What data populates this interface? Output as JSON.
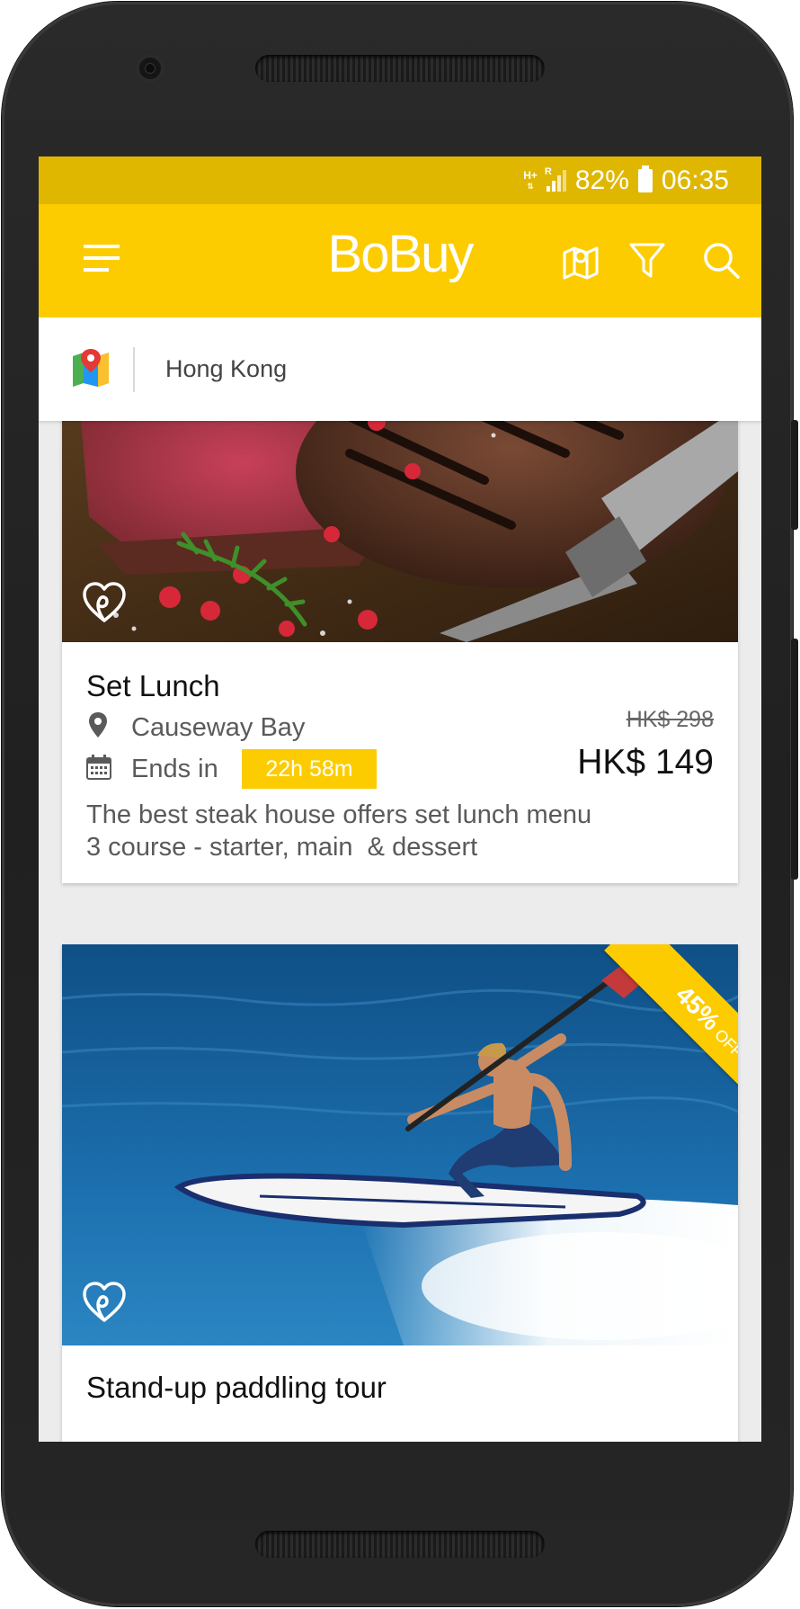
{
  "status_bar": {
    "network_top": "H+",
    "network_bottom": "R",
    "battery": "82%",
    "time": "06:35"
  },
  "app_bar": {
    "title": "BoBuy",
    "menu_icon": "hamburger-menu-icon",
    "map_icon": "map-icon",
    "filter_icon": "filter-icon",
    "search_icon": "search-icon"
  },
  "location": {
    "icon": "map-pin-icon",
    "city": "Hong Kong"
  },
  "deals": [
    {
      "title": "Set Lunch",
      "place": "Causeway Bay",
      "ends_label": "Ends in",
      "countdown": "22h 58m",
      "original_price": "HK$ 298",
      "price": "HK$ 149",
      "description_line1": "The best steak house offers set lunch menu",
      "description_line2": "3 course - starter, main  & dessert"
    },
    {
      "title": "Stand-up paddling tour",
      "discount": "45%",
      "discount_suffix": "OFF"
    }
  ],
  "colors": {
    "brand_yellow": "#fccc00",
    "status_bar": "#e0b700"
  }
}
